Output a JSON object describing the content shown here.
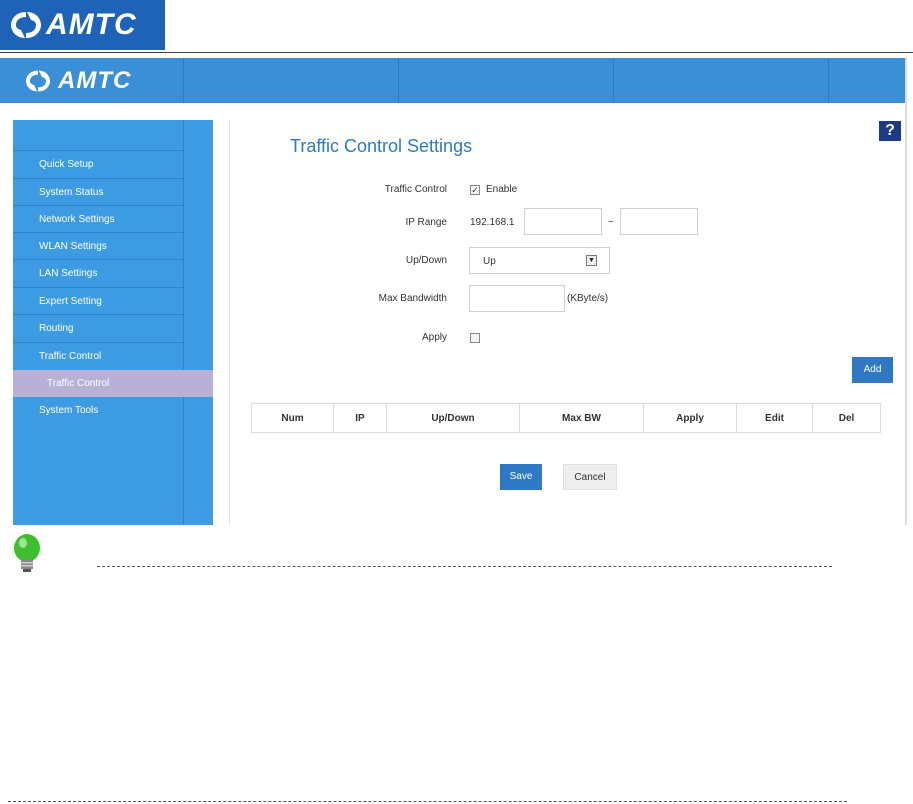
{
  "doc_header": {
    "brand": "AMTC"
  },
  "router_ui": {
    "brand": "AMTC",
    "sidebar": {
      "items": [
        {
          "label": "Quick Setup"
        },
        {
          "label": "System Status"
        },
        {
          "label": "Network Settings"
        },
        {
          "label": "WLAN Settings"
        },
        {
          "label": "LAN Settings"
        },
        {
          "label": "Expert Setting"
        },
        {
          "label": "Routing"
        },
        {
          "label": "Traffic Control"
        },
        {
          "label": "Traffic Control"
        },
        {
          "label": "System Tools"
        }
      ]
    },
    "help_label": "?",
    "page_title": "Traffic Control Settings",
    "form": {
      "traffic_control_label": "Traffic Control",
      "enable_label": "Enable",
      "enable_checked": true,
      "ip_range_label": "IP Range",
      "ip_prefix": "192.168.1",
      "ip_separator": "~",
      "ip_start_value": "",
      "ip_end_value": "",
      "updown_label": "Up/Down",
      "updown_value": "Up",
      "max_bw_label": "Max Bandwidth",
      "max_bw_value": "",
      "max_bw_unit": "(KByte/s)",
      "apply_label": "Apply",
      "apply_checked": false
    },
    "add_button": "Add",
    "table": {
      "columns": [
        "Num",
        "IP",
        "Up/Down",
        "Max BW",
        "Apply",
        "Edit",
        "Del"
      ]
    },
    "save_button": "Save",
    "cancel_button": "Cancel"
  },
  "colors": {
    "header": "#3b8fd6",
    "sidebar": "#3d9be3",
    "selected_item": "#b9b0d8",
    "button": "#2f78c4",
    "title": "#2a7bc8",
    "help_icon": "#1b3a8a",
    "tip_bulb": "#3fbf2f"
  },
  "icons": {
    "brand": "amtc-logo-icon",
    "help": "question-icon",
    "tip": "lightbulb-icon",
    "dropdown": "chevron-down-icon"
  }
}
